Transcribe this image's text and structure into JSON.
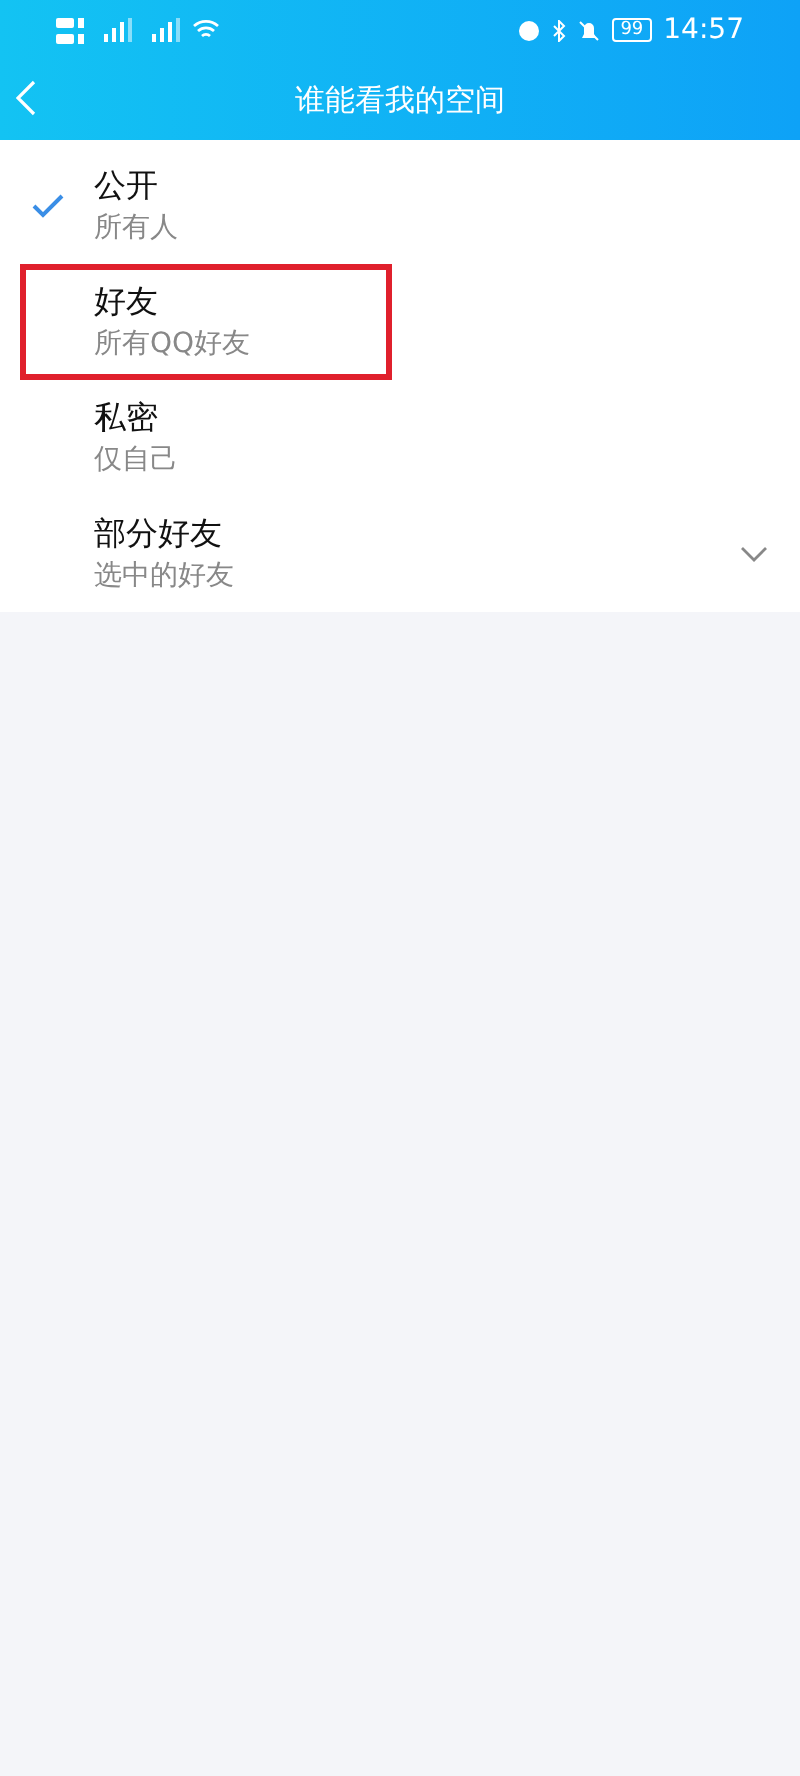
{
  "status_bar": {
    "battery": "99",
    "time": "14:57"
  },
  "nav": {
    "title": "谁能看我的空间"
  },
  "options": [
    {
      "title": "公开",
      "subtitle": "所有人",
      "selected": true,
      "highlighted": false,
      "expandable": false
    },
    {
      "title": "好友",
      "subtitle": "所有QQ好友",
      "selected": false,
      "highlighted": true,
      "expandable": false
    },
    {
      "title": "私密",
      "subtitle": "仅自己",
      "selected": false,
      "highlighted": false,
      "expandable": false
    },
    {
      "title": "部分好友",
      "subtitle": "选中的好友",
      "selected": false,
      "highlighted": false,
      "expandable": true
    }
  ]
}
